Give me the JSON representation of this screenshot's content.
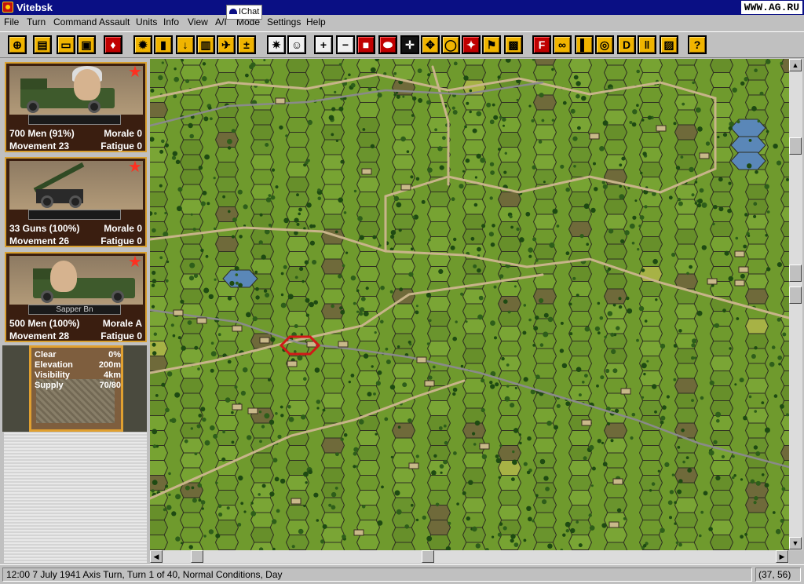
{
  "window": {
    "title": "Vitebsk",
    "watermark": "WWW.AG.RU"
  },
  "menu": [
    "File",
    "Turn",
    "Command",
    "Assault",
    "Units",
    "Info",
    "View",
    "A/I",
    "Mode",
    "Settings",
    "Help"
  ],
  "ichat": {
    "label": "IChat"
  },
  "toolbar": {
    "buttons": [
      {
        "name": "target-icon",
        "glyph": "⊕"
      },
      {
        "name": "move-icon",
        "glyph": "▤"
      },
      {
        "name": "open-icon",
        "glyph": "▭"
      },
      {
        "name": "save-icon",
        "glyph": "▣"
      },
      {
        "name": "info-icon",
        "glyph": "♦"
      },
      {
        "name": "settings-icon",
        "glyph": "✹"
      },
      {
        "name": "column-icon",
        "glyph": "▮"
      },
      {
        "name": "dig-icon",
        "glyph": "↓"
      },
      {
        "name": "rail-icon",
        "glyph": "▥"
      },
      {
        "name": "aircraft-icon",
        "glyph": "✈"
      },
      {
        "name": "reinforce-icon",
        "glyph": "±"
      },
      {
        "name": "explosion-icon",
        "glyph": "✷"
      },
      {
        "name": "leader-icon",
        "glyph": "☺"
      },
      {
        "name": "zoom-in-icon",
        "glyph": "+"
      },
      {
        "name": "zoom-out-icon",
        "glyph": "−"
      },
      {
        "name": "unit-icon",
        "glyph": "■"
      },
      {
        "name": "hex-red-icon",
        "glyph": "⬬"
      },
      {
        "name": "crosshair-icon",
        "glyph": "✛"
      },
      {
        "name": "objective-icon",
        "glyph": "✥"
      },
      {
        "name": "ellipse-icon",
        "glyph": "◯"
      },
      {
        "name": "star-icon",
        "glyph": "✦"
      },
      {
        "name": "flag-icon",
        "glyph": "⚑"
      },
      {
        "name": "document-icon",
        "glyph": "▩"
      },
      {
        "name": "fire-icon",
        "glyph": "F"
      },
      {
        "name": "binoculars-icon",
        "glyph": "∞"
      },
      {
        "name": "ammo-icon",
        "glyph": "▌"
      },
      {
        "name": "disk-icon",
        "glyph": "◎"
      },
      {
        "name": "d-icon",
        "glyph": "D"
      },
      {
        "name": "pause-icon",
        "glyph": "‖"
      },
      {
        "name": "note-icon",
        "glyph": "▨"
      },
      {
        "name": "help-icon",
        "glyph": "?"
      }
    ]
  },
  "units": [
    {
      "name": "",
      "strength": "700 Men (91%)",
      "morale_label": "Morale",
      "morale": "0",
      "movement_label": "Movement",
      "movement": "23",
      "fatigue_label": "Fatigue",
      "fatigue": "0"
    },
    {
      "name": "",
      "strength": "33 Guns (100%)",
      "morale_label": "Morale",
      "morale": "0",
      "movement_label": "Movement",
      "movement": "26",
      "fatigue_label": "Fatigue",
      "fatigue": "0"
    },
    {
      "name": "Sapper Bn",
      "strength": "500 Men (100%)",
      "morale_label": "Morale",
      "morale": "A",
      "movement_label": "Movement",
      "movement": "28",
      "fatigue_label": "Fatigue",
      "fatigue": "0"
    }
  ],
  "terrain": {
    "rows": [
      {
        "label": "Clear",
        "value": "0%"
      },
      {
        "label": "Elevation",
        "value": "200m"
      },
      {
        "label": "Visibility",
        "value": "4km"
      },
      {
        "label": "Supply",
        "value": "70/80"
      }
    ]
  },
  "status": {
    "text": "12:00 7 July 1941 Axis Turn, Turn 1 of 40, Normal Conditions, Day",
    "coords": "(37, 56)"
  },
  "colors": {
    "titlebar": "#0a0f84",
    "map_green": "#6f9a2d",
    "hex_grid": "#2f2f22",
    "road": "#c8b48a",
    "rail": "#8a8a8a",
    "selection": "#d01818"
  }
}
